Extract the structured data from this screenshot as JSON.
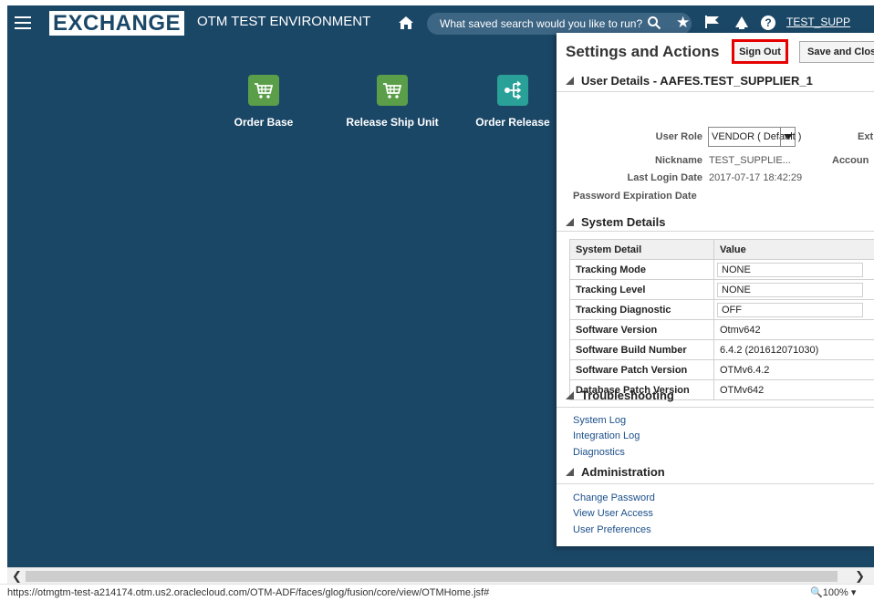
{
  "header": {
    "logo_text": "EXCHANGE",
    "environment": "OTM TEST ENVIRONMENT",
    "search_placeholder": "What saved search would you like to run?",
    "user_name": "TEST_SUPP"
  },
  "tiles": [
    {
      "label": "Order Base",
      "icon": "shopping-cart-icon",
      "color": "#5b9e4a"
    },
    {
      "label": "Release Ship Unit",
      "icon": "shopping-cart-icon",
      "color": "#5b9e4a"
    },
    {
      "label": "Order Release",
      "icon": "share-icon",
      "color": "#2aa198"
    }
  ],
  "panel": {
    "title": "Settings and Actions",
    "sign_out": "Sign Out",
    "save_close": "Save and Close",
    "user_details": {
      "heading": "User Details - AAFES.TEST_SUPPLIER_1",
      "role_label": "User Role",
      "role_value": "VENDOR ( Default )",
      "ext_label": "Ext",
      "nickname_label": "Nickname",
      "nickname_value": "TEST_SUPPLIE...",
      "account_label": "Accoun",
      "last_login_label": "Last Login Date",
      "last_login_value": "2017-07-17 18:42:29",
      "pwd_exp_label": "Password Expiration Date"
    },
    "system_details": {
      "heading": "System Details",
      "col_detail": "System Detail",
      "col_value": "Value",
      "rows": [
        {
          "k": "Tracking Mode",
          "v": "NONE"
        },
        {
          "k": "Tracking Level",
          "v": "NONE"
        },
        {
          "k": "Tracking Diagnostic",
          "v": "OFF"
        },
        {
          "k": "Software Version",
          "v": "Otmv642"
        },
        {
          "k": "Software Build Number",
          "v": "6.4.2 (201612071030)"
        },
        {
          "k": "Software Patch Version",
          "v": "OTMv6.4.2"
        },
        {
          "k": "Database Patch Version",
          "v": "OTMv642"
        }
      ]
    },
    "troubleshooting": {
      "heading": "Troubleshooting",
      "links": [
        "System Log",
        "Integration Log",
        "Diagnostics"
      ]
    },
    "administration": {
      "heading": "Administration",
      "links": [
        "Change Password",
        "View User Access",
        "User Preferences"
      ]
    }
  },
  "statusbar": {
    "url": "https://otmgtm-test-a214174.otm.us2.oraclecloud.com/OTM-ADF/faces/glog/fusion/core/view/OTMHome.jsf#",
    "zoom": "100%"
  }
}
